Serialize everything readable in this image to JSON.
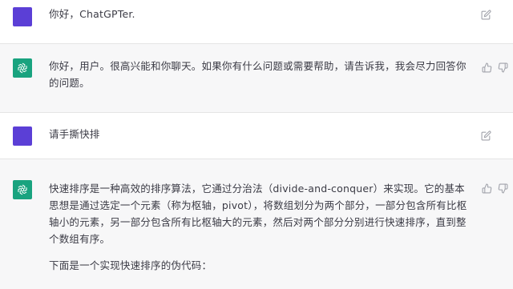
{
  "messages": [
    {
      "role": "user",
      "text": "你好，ChatGPTer."
    },
    {
      "role": "assistant",
      "text": "你好，用户。很高兴能和你聊天。如果你有什么问题或需要帮助，请告诉我，我会尽力回答你的问题。"
    },
    {
      "role": "user",
      "text": "请手撕快排"
    },
    {
      "role": "assistant",
      "paragraphs": [
        "快速排序是一种高效的排序算法，它通过分治法（divide-and-conquer）来实现。它的基本思想是通过选定一个元素（称为枢轴，pivot），将数组划分为两个部分，一部分包含所有比枢轴小的元素，另一部分包含所有比枢轴大的元素，然后对两个部分分别进行快速排序，直到整个数组有序。",
        "下面是一个实现快速排序的伪代码："
      ]
    }
  ],
  "icons": {
    "edit": "edit-icon",
    "thumbs_up": "thumbs-up-icon",
    "thumbs_down": "thumbs-down-icon",
    "assistant_logo": "openai-logo-icon"
  },
  "colors": {
    "user_avatar": "#5b3fd6",
    "assistant_avatar": "#19a37f",
    "assistant_bg": "#f7f7f8",
    "icon_gray": "#9ea0a8"
  }
}
